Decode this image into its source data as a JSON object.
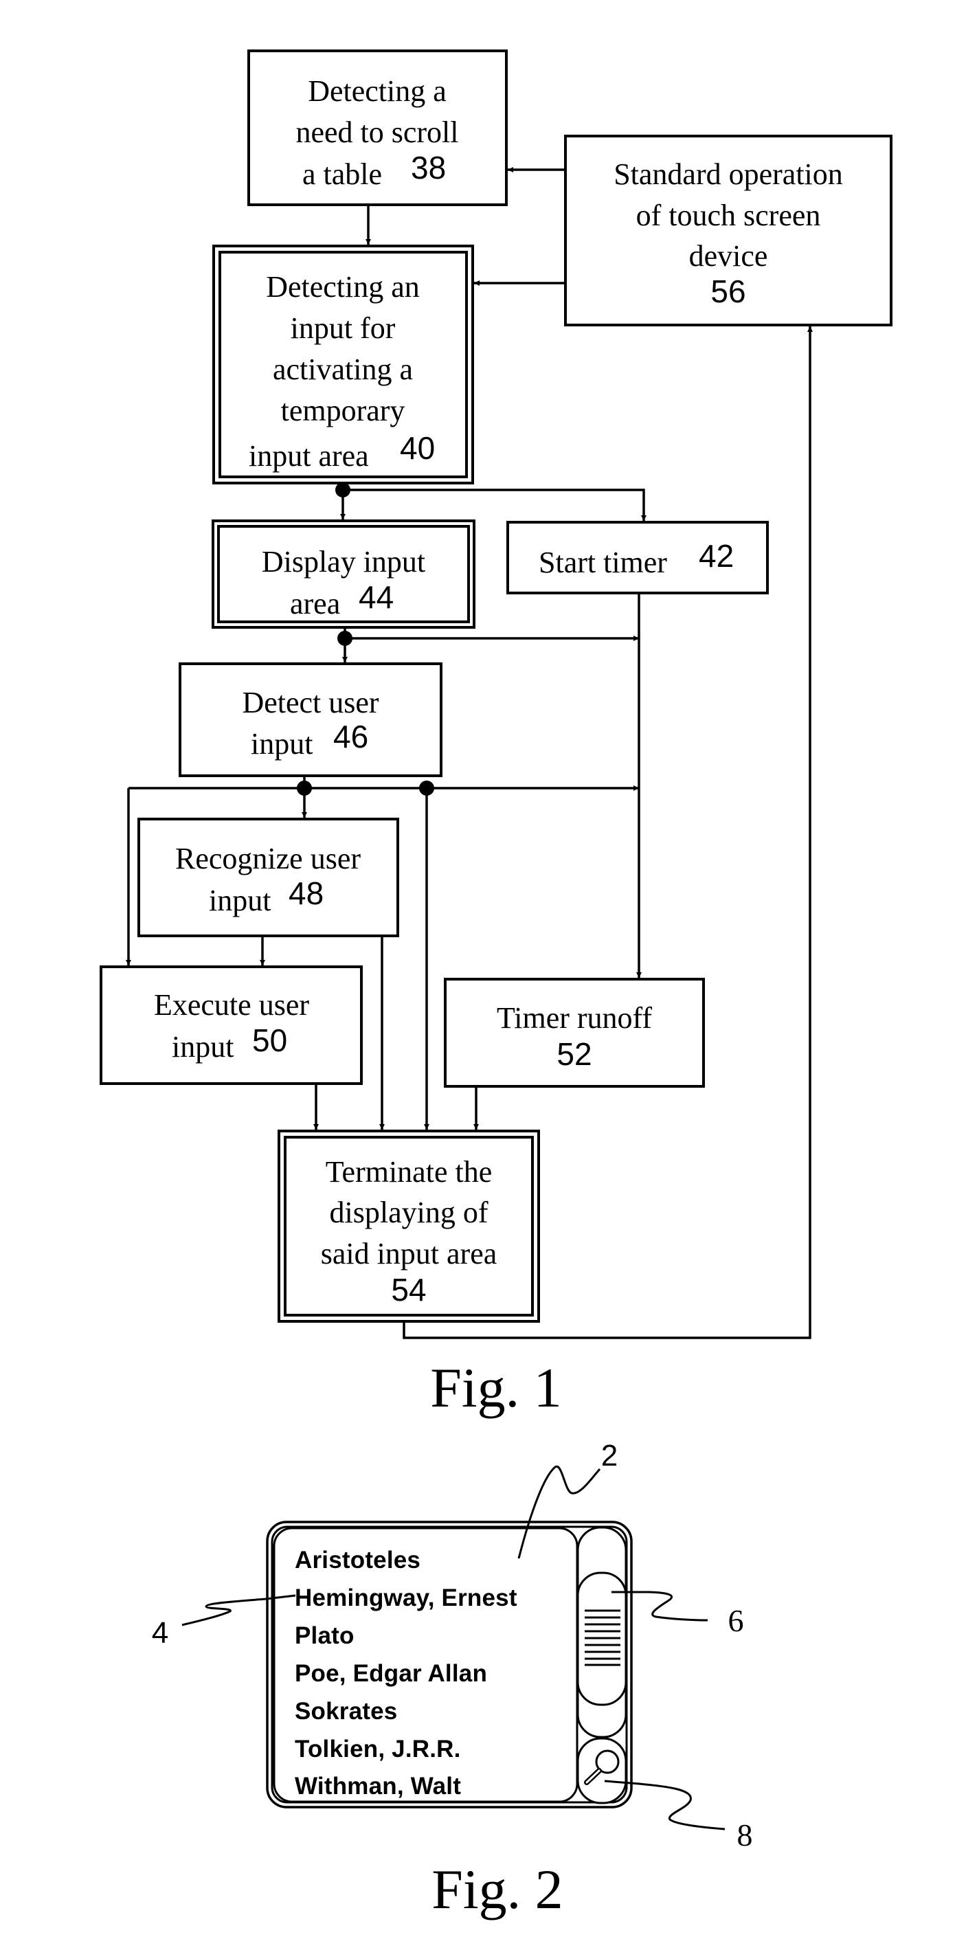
{
  "figure1": {
    "caption": "Fig. 1",
    "steps": {
      "s38": {
        "lines": [
          "Detecting a",
          "need to scroll",
          "a table"
        ],
        "number": "38"
      },
      "s40": {
        "lines": [
          "Detecting an",
          "input for",
          "activating a",
          "temporary",
          "input area"
        ],
        "number": "40"
      },
      "s42": {
        "lines": [
          "Start timer"
        ],
        "number": "42"
      },
      "s44": {
        "lines": [
          "Display input",
          "area"
        ],
        "number": "44"
      },
      "s46": {
        "lines": [
          "Detect user",
          "input"
        ],
        "number": "46"
      },
      "s48": {
        "lines": [
          "Recognize user",
          "input"
        ],
        "number": "48"
      },
      "s50": {
        "lines": [
          "Execute user",
          "input"
        ],
        "number": "50"
      },
      "s52": {
        "lines": [
          "Timer runoff"
        ],
        "number": "52"
      },
      "s54": {
        "lines": [
          "Terminate the",
          "displaying of",
          "said input area"
        ],
        "number": "54"
      },
      "s56": {
        "lines": [
          "Standard operation",
          "of touch screen",
          "device"
        ],
        "number": "56"
      }
    }
  },
  "figure2": {
    "caption": "Fig. 2",
    "list_items": [
      "Aristoteles",
      "Hemingway, Ernest",
      "Plato",
      "Poe, Edgar Allan",
      "Sokrates",
      "Tolkien, J.R.R.",
      "Withman, Walt"
    ],
    "reference_labels": {
      "device": "2",
      "list_item": "4",
      "scroll_thumb": "6",
      "search_button": "8"
    },
    "icons": {
      "search": "magnifier-icon",
      "grip": "grip-lines-icon"
    }
  }
}
